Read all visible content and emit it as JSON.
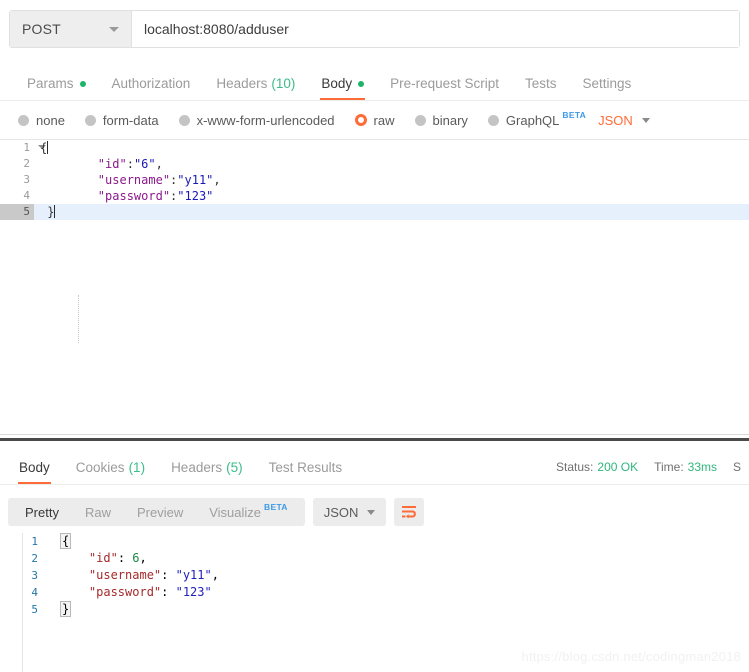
{
  "request": {
    "method": "POST",
    "url": "localhost:8080/adduser",
    "tabs": [
      {
        "label": "Params",
        "badge": "dot",
        "active": false
      },
      {
        "label": "Authorization",
        "badge": "",
        "active": false
      },
      {
        "label": "Headers",
        "badge": "(10)",
        "active": false
      },
      {
        "label": "Body",
        "badge": "dot",
        "active": true
      },
      {
        "label": "Pre-request Script",
        "badge": "",
        "active": false
      },
      {
        "label": "Tests",
        "badge": "",
        "active": false
      },
      {
        "label": "Settings",
        "badge": "",
        "active": false
      }
    ],
    "body_types": [
      {
        "label": "none",
        "selected": false,
        "beta": ""
      },
      {
        "label": "form-data",
        "selected": false,
        "beta": ""
      },
      {
        "label": "x-www-form-urlencoded",
        "selected": false,
        "beta": ""
      },
      {
        "label": "raw",
        "selected": true,
        "beta": ""
      },
      {
        "label": "binary",
        "selected": false,
        "beta": ""
      },
      {
        "label": "GraphQL",
        "selected": false,
        "beta": "BETA"
      }
    ],
    "format": "JSON",
    "editor": {
      "lines": [
        {
          "no": "1",
          "open_brace": "{",
          "indent": "",
          "key": "",
          "colon": "",
          "value": "",
          "comma": "",
          "close_brace": "",
          "active": false
        },
        {
          "no": "2",
          "open_brace": "",
          "indent": "        ",
          "key": "\"id\"",
          "colon": ":",
          "value": "\"6\"",
          "comma": ",",
          "close_brace": "",
          "active": false
        },
        {
          "no": "3",
          "open_brace": "",
          "indent": "        ",
          "key": "\"username\"",
          "colon": ":",
          "value": "\"y11\"",
          "comma": ",",
          "close_brace": "",
          "active": false
        },
        {
          "no": "4",
          "open_brace": "",
          "indent": "        ",
          "key": "\"password\"",
          "colon": ":",
          "value": "\"123\"",
          "comma": "",
          "close_brace": "",
          "active": false
        },
        {
          "no": "5",
          "open_brace": "",
          "indent": " ",
          "key": "",
          "colon": "",
          "value": "",
          "comma": "",
          "close_brace": "}",
          "active": true
        }
      ]
    }
  },
  "response": {
    "tabs": [
      {
        "label": "Body",
        "badge": "",
        "active": true
      },
      {
        "label": "Cookies",
        "badge": "(1)",
        "active": false
      },
      {
        "label": "Headers",
        "badge": "(5)",
        "active": false
      },
      {
        "label": "Test Results",
        "badge": "",
        "active": false
      }
    ],
    "status_label": "Status:",
    "status_value": "200 OK",
    "time_label": "Time:",
    "time_value": "33ms",
    "size_label": "S",
    "view_modes": [
      {
        "label": "Pretty",
        "active": true,
        "beta": ""
      },
      {
        "label": "Raw",
        "active": false,
        "beta": ""
      },
      {
        "label": "Preview",
        "active": false,
        "beta": ""
      },
      {
        "label": "Visualize",
        "active": false,
        "beta": "BETA"
      }
    ],
    "format": "JSON",
    "wrap_icon": "word-wrap-icon",
    "editor": {
      "lines": [
        {
          "no": "1",
          "open_brace": "{",
          "indent": "",
          "key": "",
          "colon": "",
          "value": "",
          "comma": "",
          "close_brace": "",
          "value_kind": ""
        },
        {
          "no": "2",
          "open_brace": "",
          "indent": "    ",
          "key": "\"id\"",
          "colon": ": ",
          "value": "6",
          "comma": ",",
          "close_brace": "",
          "value_kind": "num"
        },
        {
          "no": "3",
          "open_brace": "",
          "indent": "    ",
          "key": "\"username\"",
          "colon": ": ",
          "value": "\"y11\"",
          "comma": ",",
          "close_brace": "",
          "value_kind": "str"
        },
        {
          "no": "4",
          "open_brace": "",
          "indent": "    ",
          "key": "\"password\"",
          "colon": ": ",
          "value": "\"123\"",
          "comma": "",
          "close_brace": "",
          "value_kind": "str"
        },
        {
          "no": "5",
          "open_brace": "",
          "indent": "",
          "key": "",
          "colon": "",
          "value": "",
          "comma": "",
          "close_brace": "}",
          "value_kind": ""
        }
      ]
    }
  },
  "watermark": "https://blog.csdn.net/codingman2018",
  "colors": {
    "accent": "#ff6c37",
    "green": "#2fb67c",
    "beta_blue": "#3c9ae8",
    "active_line": "#e6f0fd"
  }
}
